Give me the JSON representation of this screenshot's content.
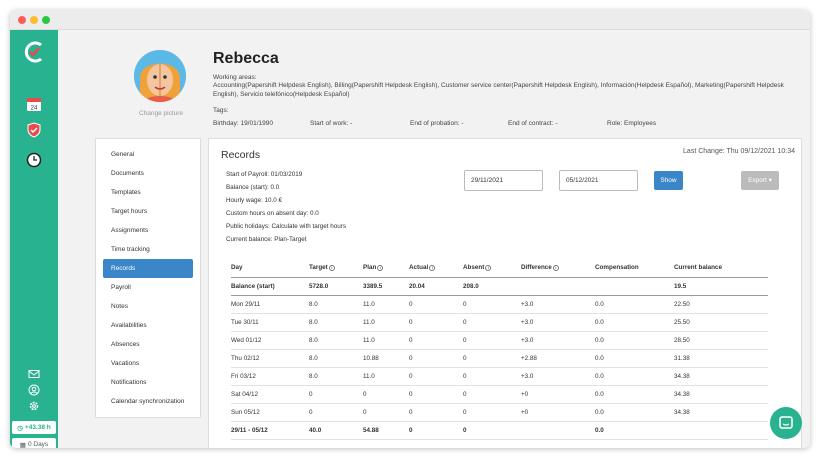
{
  "app": {
    "pill_hours": "+43.38 h",
    "pill_days": "0 Days"
  },
  "profile": {
    "name": "Rebecca",
    "change_picture": "Change picture",
    "working_areas_label": "Working areas:",
    "working_areas_line1": "Accounting(Papershift Helpdesk English), Billing(Papershift Helpdesk English), Customer service center(Papershift Helpdesk English), Información(Helpdesk Español), Marketing(Papershift Helpdesk",
    "working_areas_line2": "English), Servicio telefónico(Helpdesk Español)",
    "tags_label": "Tags:",
    "birthday": "Birthday: 19/01/1990",
    "start_of_work": "Start of work: -",
    "end_of_probation": "End of probation: -",
    "end_of_contract": "End of contract: -",
    "role": "Role: Employees"
  },
  "sidebar": {
    "items": [
      {
        "label": "General"
      },
      {
        "label": "Documents"
      },
      {
        "label": "Templates"
      },
      {
        "label": "Target hours"
      },
      {
        "label": "Assignments"
      },
      {
        "label": "Time tracking"
      },
      {
        "label": "Records"
      },
      {
        "label": "Payroll"
      },
      {
        "label": "Notes"
      },
      {
        "label": "Availabilities"
      },
      {
        "label": "Absences"
      },
      {
        "label": "Vacations"
      },
      {
        "label": "Notifications"
      },
      {
        "label": "Calendar synchronization"
      }
    ],
    "active": "Records"
  },
  "records": {
    "title": "Records",
    "last_change": "Last Change: Thu 09/12/2021 10:34",
    "info": [
      "Start of Payroll: 01/03/2019",
      "Balance (start): 0.0",
      "Hourly wage: 10.0 €",
      "Custom hours on absent day: 0.0",
      "Public holidays: Calculate with target hours",
      "Current balance: Plan-Target"
    ],
    "date_from": "29/11/2021",
    "date_to": "05/12/2021",
    "show_label": "Show",
    "export_label": "Export ▾",
    "table": {
      "headers": [
        "Day",
        "Target",
        "Plan",
        "Actual",
        "Absent",
        "Difference",
        "Compensation",
        "Current balance"
      ],
      "balance_row": [
        "Balance (start)",
        "5728.0",
        "3389.5",
        "20.04",
        "208.0",
        "",
        "",
        "19.5"
      ],
      "rows": [
        [
          "Mon 29/11",
          "8.0",
          "11.0",
          "0",
          "0",
          "+3.0",
          "0.0",
          "22.50"
        ],
        [
          "Tue 30/11",
          "8.0",
          "11.0",
          "0",
          "0",
          "+3.0",
          "0.0",
          "25.50"
        ],
        [
          "Wed 01/12",
          "8.0",
          "11.0",
          "0",
          "0",
          "+3.0",
          "0.0",
          "28.50"
        ],
        [
          "Thu 02/12",
          "8.0",
          "10.88",
          "0",
          "0",
          "+2.88",
          "0.0",
          "31.38"
        ],
        [
          "Fri 03/12",
          "8.0",
          "11.0",
          "0",
          "0",
          "+3.0",
          "0.0",
          "34.38"
        ],
        [
          "Sat 04/12",
          "0",
          "0",
          "0",
          "0",
          "+0",
          "0.0",
          "34.38"
        ],
        [
          "Sun 05/12",
          "0",
          "0",
          "0",
          "0",
          "+0",
          "0.0",
          "34.38"
        ]
      ],
      "total_row": [
        "29/11 - 05/12",
        "40.0",
        "54.88",
        "0",
        "0",
        "",
        "0.0",
        ""
      ]
    }
  },
  "colors": {
    "brand": "#28b28f",
    "accent": "#3a86c8"
  }
}
